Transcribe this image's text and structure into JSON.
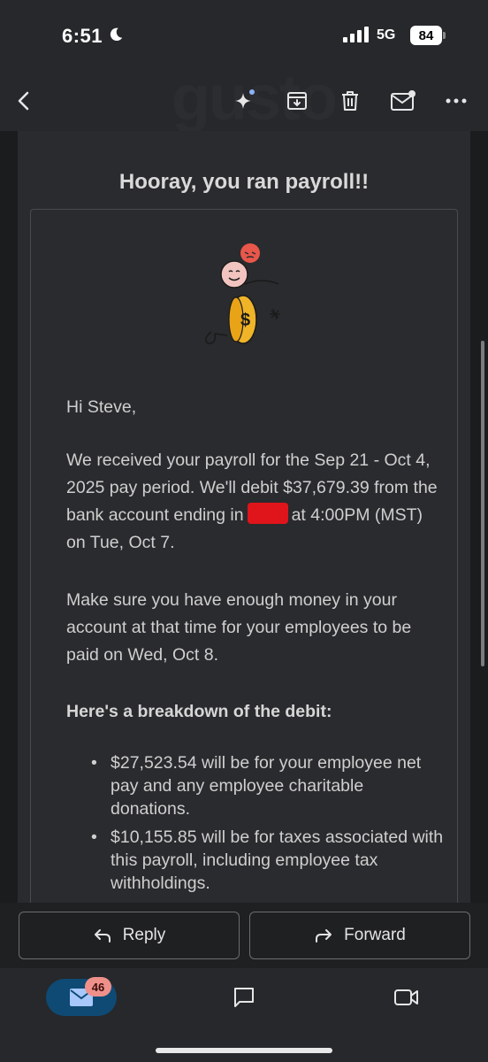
{
  "status_bar": {
    "time": "6:51",
    "network": "5G",
    "battery": "84"
  },
  "toolbar": {
    "back_icon": "back-arrow-icon",
    "brand_watermark": "gusto",
    "icons": [
      "sparkle-icon",
      "archive-icon",
      "trash-icon",
      "mark-unread-icon",
      "more-icon"
    ]
  },
  "email": {
    "heading": "Hooray, you ran payroll!!",
    "greeting": "Hi Steve,",
    "para1_line1": "We received your payroll for the Sep 21 - Oct 4, 2025 pay period. We'll debit $37,679.39 from the bank account ending in",
    "para1_line2": "at 4:00PM (MST) on Tue, Oct 7.",
    "para2": "Make sure you have enough money in your account at that time for your employees to be paid on Wed, Oct 8.",
    "breakdown_heading": "Here's a breakdown of the debit:",
    "bullets": [
      "$27,523.54 will be for your employee net pay and any employee charitable donations.",
      "$10,155.85 will be for taxes associated with this payroll, including employee tax withholdings."
    ]
  },
  "actions": {
    "reply_label": "Reply",
    "forward_label": "Forward"
  },
  "bottom_nav": {
    "mail_badge": "46"
  },
  "colors": {
    "redaction": "#e0141b",
    "nav_active": "#0e4a74",
    "badge": "#f0908a"
  }
}
